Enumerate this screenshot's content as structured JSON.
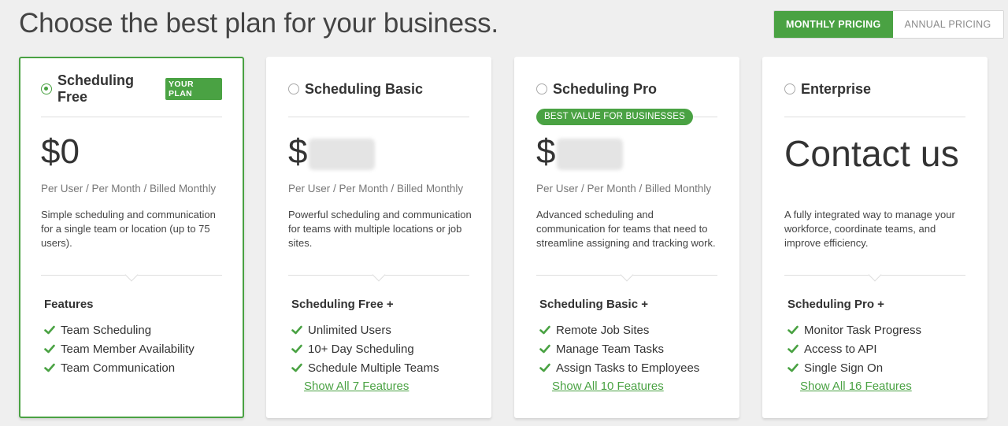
{
  "headline": "Choose the best plan for your business.",
  "pricing_toggle": {
    "monthly_label": "MONTHLY PRICING",
    "annual_label": "ANNUAL PRICING"
  },
  "colors": {
    "accent": "#4aa243",
    "background": "#efefef"
  },
  "plans": [
    {
      "name": "Scheduling Free",
      "badge": "YOUR PLAN",
      "price_symbol": "$",
      "price_value": "0",
      "billing": "Per User / Per Month / Billed Monthly",
      "description": "Simple scheduling and communication for a single team or location (up to 75 users).",
      "features_heading": "Features",
      "features": [
        "Team Scheduling",
        "Team Member Availability",
        "Team Communication"
      ],
      "show_all": ""
    },
    {
      "name": "Scheduling Basic",
      "price_symbol": "$",
      "billing": "Per User / Per Month / Billed Monthly",
      "description": "Powerful scheduling and communication for teams with multiple locations or job sites.",
      "features_heading": "Scheduling Free +",
      "features": [
        "Unlimited Users",
        "10+ Day Scheduling",
        "Schedule Multiple Teams"
      ],
      "show_all": "Show All 7 Features"
    },
    {
      "name": "Scheduling Pro",
      "badge": "BEST VALUE FOR BUSINESSES",
      "price_symbol": "$",
      "billing": "Per User / Per Month / Billed Monthly",
      "description": "Advanced scheduling and communication for teams that need to streamline assigning and tracking work.",
      "features_heading": "Scheduling Basic +",
      "features": [
        "Remote Job Sites",
        "Manage Team Tasks",
        "Assign Tasks to Employees"
      ],
      "show_all": "Show All 10 Features"
    },
    {
      "name": "Enterprise",
      "price_text": "Contact us",
      "description": "A fully integrated way to manage your workforce, coordinate teams, and improve efficiency.",
      "features_heading": "Scheduling Pro +",
      "features": [
        "Monitor Task Progress",
        "Access to API",
        "Single Sign On"
      ],
      "show_all": "Show All 16 Features"
    }
  ]
}
